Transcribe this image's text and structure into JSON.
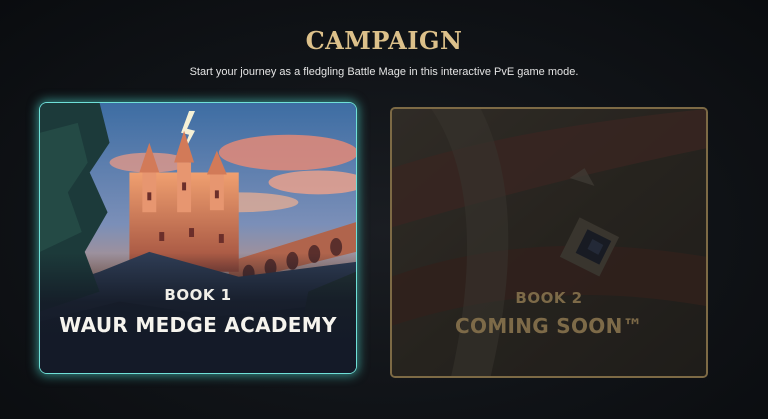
{
  "header": {
    "title": "CAMPAIGN",
    "subtitle": "Start your journey as a fledgling Battle Mage in this interactive PvE game mode."
  },
  "cards": [
    {
      "book": "BOOK 1",
      "name": "WAUR MEDGE ACADEMY",
      "state": "available",
      "accent": "#6fe0d8"
    },
    {
      "book": "BOOK 2",
      "name": "COMING SOON™",
      "state": "locked",
      "accent": "#7d6a45"
    }
  ],
  "colors": {
    "title": "#dcc08a",
    "background": "#101317",
    "locked_text": "#7d6a48"
  }
}
